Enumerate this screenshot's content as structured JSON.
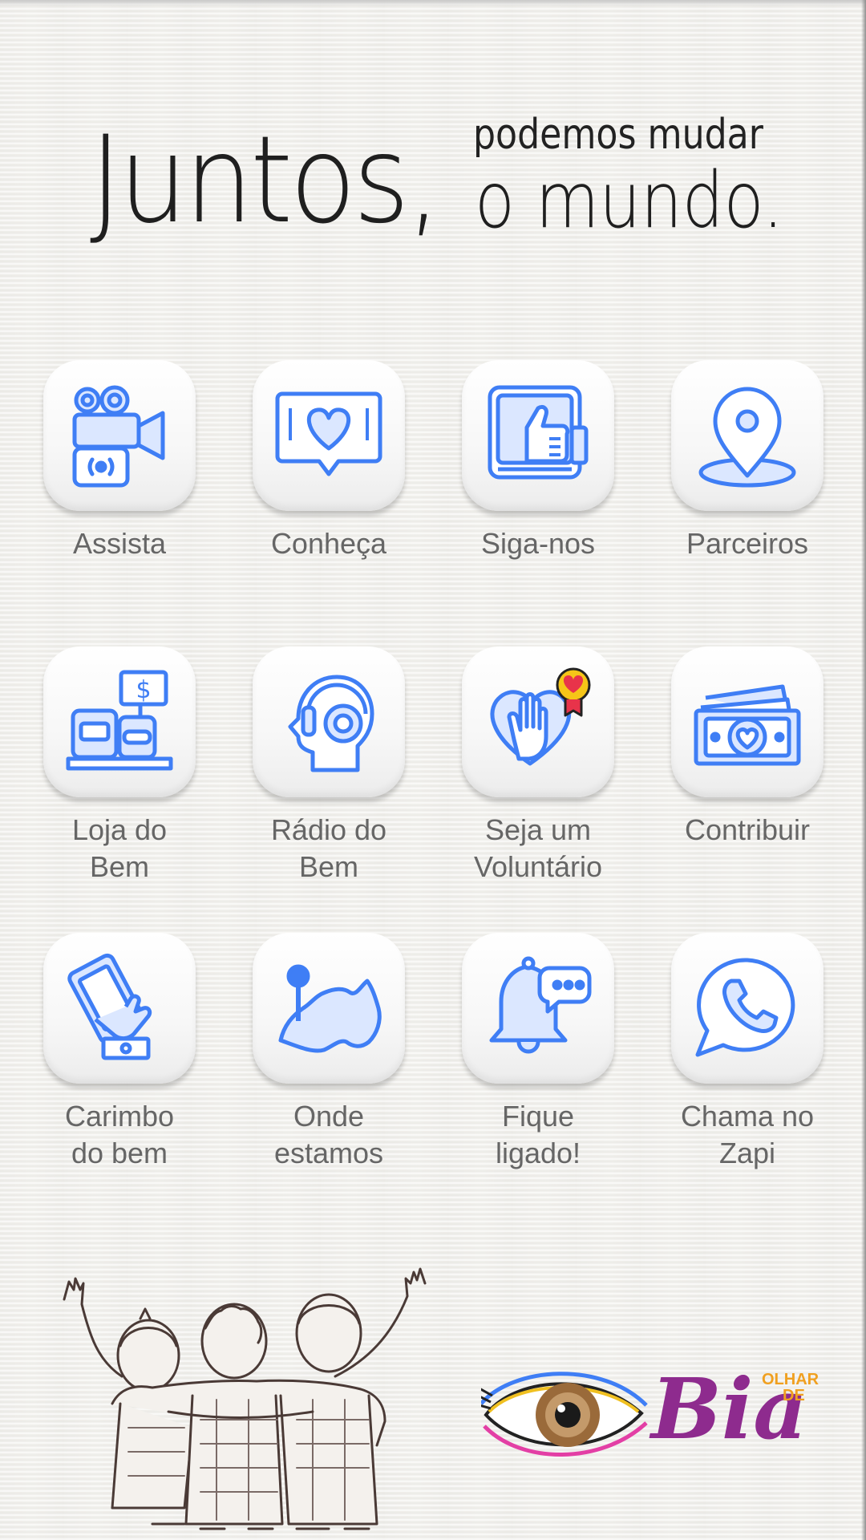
{
  "header": {
    "word_main": "Juntos,",
    "line_small": "podemos mudar",
    "line_big": "o mundo."
  },
  "menu": [
    {
      "label_lines": [
        "Assista",
        ""
      ],
      "icon": "video-camera-icon"
    },
    {
      "label_lines": [
        "Conheça",
        ""
      ],
      "icon": "heart-speech-bubble-icon"
    },
    {
      "label_lines": [
        "Siga-nos",
        ""
      ],
      "icon": "thumbs-up-screen-icon"
    },
    {
      "label_lines": [
        "Parceiros",
        ""
      ],
      "icon": "location-pin-icon"
    },
    {
      "label_lines": [
        "Loja do",
        "Bem"
      ],
      "icon": "store-jars-icon"
    },
    {
      "label_lines": [
        "Rádio do",
        "Bem"
      ],
      "icon": "headphones-head-icon"
    },
    {
      "label_lines": [
        "Seja um",
        "Voluntário"
      ],
      "icon": "heart-hand-badge-icon"
    },
    {
      "label_lines": [
        "Contribuir",
        ""
      ],
      "icon": "money-bills-heart-icon"
    },
    {
      "label_lines": [
        "Carimbo",
        "do bem"
      ],
      "icon": "hand-phone-icon"
    },
    {
      "label_lines": [
        "Onde",
        "estamos"
      ],
      "icon": "map-pin-icon"
    },
    {
      "label_lines": [
        "Fique",
        "ligado!"
      ],
      "icon": "bell-chat-icon"
    },
    {
      "label_lines": [
        "Chama no",
        "Zapi"
      ],
      "icon": "whatsapp-icon"
    }
  ],
  "logo": {
    "brand_main": "Bia",
    "brand_small_1": "OLHAR",
    "brand_small_2": "DE"
  },
  "colors": {
    "icon_stroke": "#3f7ef5",
    "icon_fill": "#dbe7ff",
    "label_text": "#666666",
    "brand_purple": "#8e2b8e",
    "brand_orange": "#f0a020"
  }
}
